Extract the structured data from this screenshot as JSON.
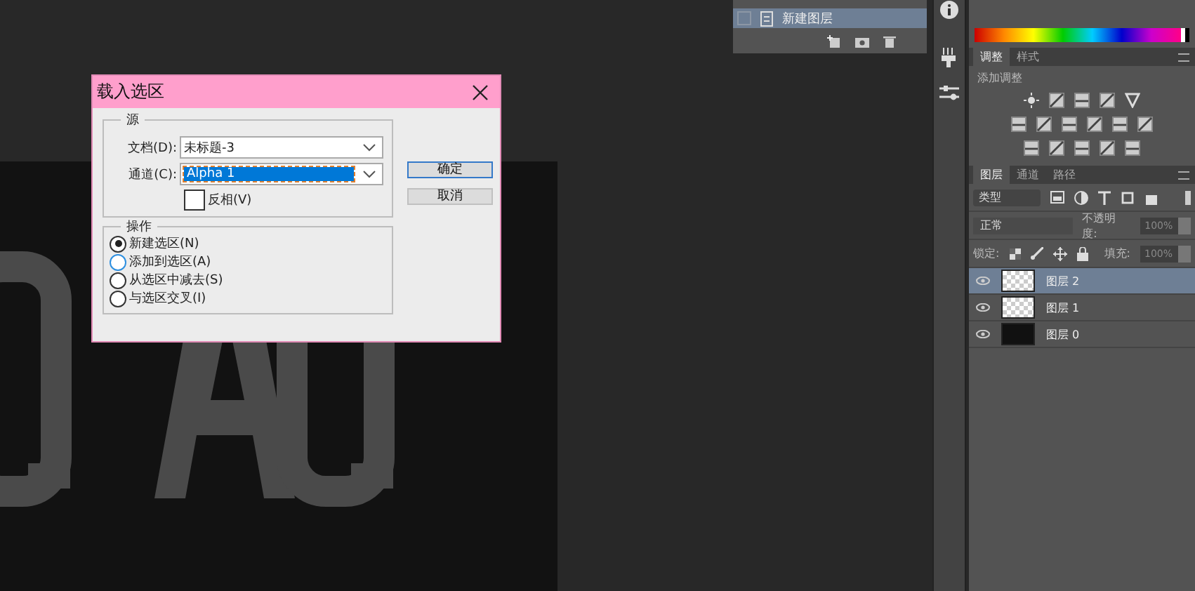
{
  "mini_layers_panel": {
    "row": {
      "label": "新建图层",
      "selected": true
    }
  },
  "dialog": {
    "title": "载入选区",
    "source": {
      "legend": "源",
      "document": {
        "label": "文档(D):",
        "value": "未标题-3"
      },
      "channel": {
        "label": "通道(C):",
        "value": "Alpha 1"
      },
      "invert": {
        "label": "反相(V)",
        "checked": false
      }
    },
    "operation": {
      "legend": "操作",
      "options": [
        {
          "label": "新建选区(N)",
          "selected": true
        },
        {
          "label": "添加到选区(A)",
          "selected": false
        },
        {
          "label": "从选区中减去(S)",
          "selected": false
        },
        {
          "label": "与选区交叉(I)",
          "selected": false
        }
      ]
    },
    "buttons": [
      {
        "label": "确定",
        "default": true
      },
      {
        "label": "取消",
        "default": false
      }
    ]
  },
  "adjustments_panel": {
    "tabs": [
      {
        "label": "调整",
        "selected": true
      },
      {
        "label": "样式",
        "selected": false
      }
    ],
    "heading": "添加调整"
  },
  "layers_panel": {
    "tabs": [
      {
        "label": "图层",
        "selected": true
      },
      {
        "label": "通道",
        "selected": false
      },
      {
        "label": "路径",
        "selected": false
      }
    ],
    "filter": "类型",
    "blend_mode": "正常",
    "opacity_label": "不透明度:",
    "opacity": "100%",
    "lock_label": "锁定:",
    "fill_label": "填充:",
    "fill": "100%",
    "layers": [
      {
        "name": "图层 2",
        "selected": true,
        "kind": "transparent"
      },
      {
        "name": "图层 1",
        "selected": false,
        "kind": "transparent"
      },
      {
        "name": "图层 0",
        "selected": false,
        "kind": "black"
      }
    ]
  }
}
